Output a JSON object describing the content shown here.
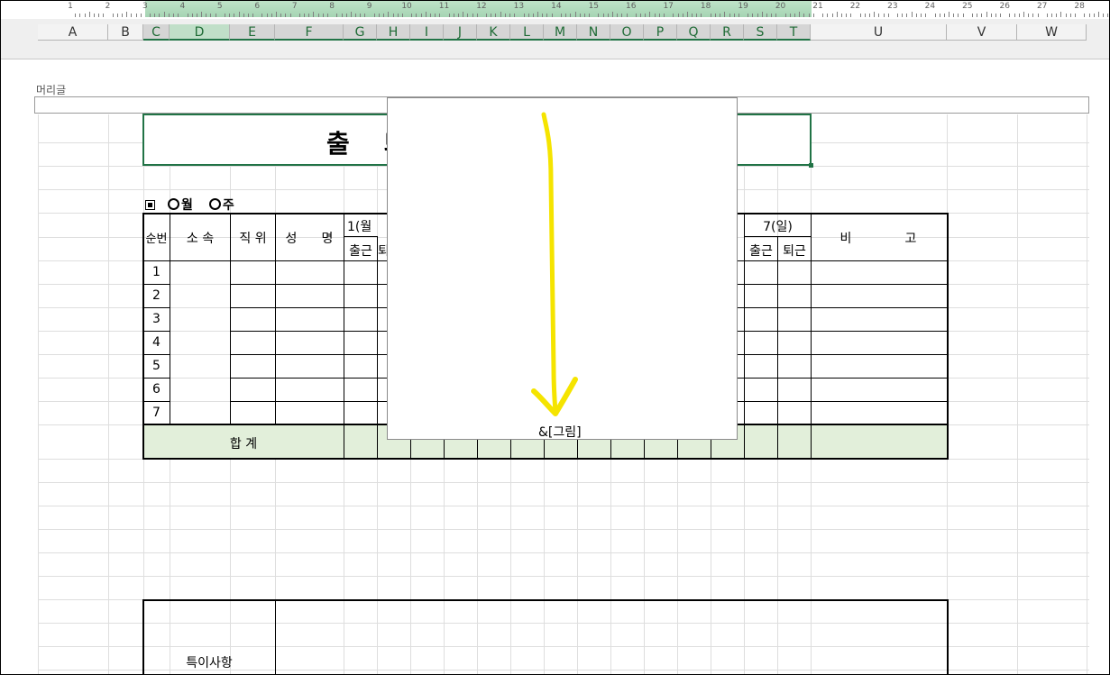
{
  "ruler": {
    "numbers": [
      "1",
      "2",
      "3",
      "4",
      "5",
      "6",
      "7",
      "8",
      "9",
      "10",
      "11",
      "12",
      "13",
      "14",
      "15",
      "16",
      "17",
      "18",
      "19",
      "20",
      "21",
      "22",
      "23",
      "24",
      "25",
      "26",
      "27",
      "28"
    ]
  },
  "columns": [
    "A",
    "B",
    "C",
    "D",
    "E",
    "F",
    "G",
    "H",
    "I",
    "J",
    "K",
    "L",
    "M",
    "N",
    "O",
    "P",
    "Q",
    "R",
    "S",
    "T",
    "U",
    "V",
    "W"
  ],
  "header_area": {
    "label": "머리글"
  },
  "sheet": {
    "title_visible": "출 퇴",
    "week_line": {
      "month_label": "월",
      "week_label": "주"
    },
    "table_headers": {
      "seq": "순번",
      "dept": "소 속",
      "position": "직 위",
      "name_a": "성",
      "name_b": "명",
      "day1": "1(월",
      "day7": "7(일)",
      "checkin": "출근",
      "checkout_partial": "퇴",
      "checkout": "퇴근",
      "remarks_a": "비",
      "remarks_b": "고"
    },
    "rows": [
      "1",
      "2",
      "3",
      "4",
      "5",
      "6",
      "7"
    ],
    "total_label": "합 계",
    "notes_label": "특이사항"
  },
  "overlay": {
    "picture_field": "&[그림]",
    "arrow_color": "#f5e400"
  },
  "colors": {
    "accent_green": "#217346",
    "total_fill": "#e2efda"
  }
}
